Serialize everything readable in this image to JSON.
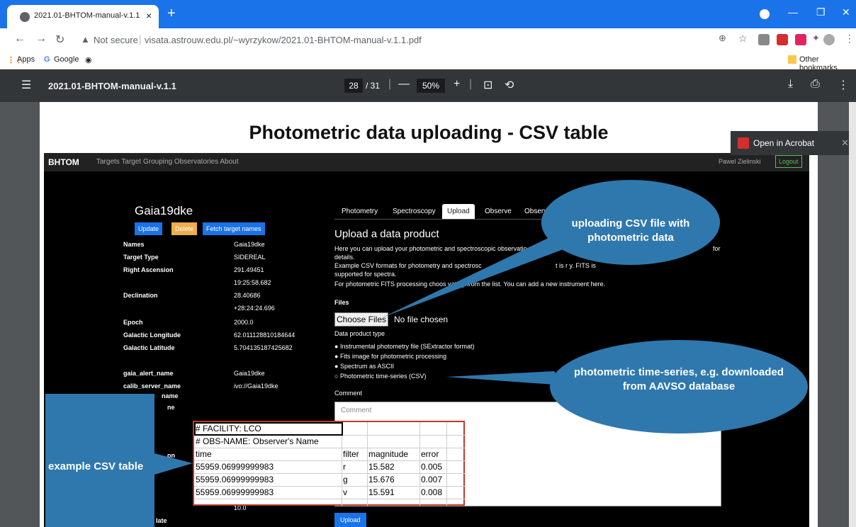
{
  "browser": {
    "tab_title": "2021.01-BHTOM-manual-v.1.1",
    "tab_close": "×",
    "new_tab": "+",
    "not_secure": "Not secure",
    "url": "visata.astrouw.edu.pl/~wyrzykow/2021.01-BHTOM-manual-v.1.1.pdf",
    "bookmarks": [
      "Apps",
      "Google"
    ],
    "other_bookmarks": "Other bookmarks"
  },
  "pdf_viewer": {
    "title": "2021.01-BHTOM-manual-v.1.1",
    "page_current": "28",
    "page_total": "/ 31",
    "zoom": "50%",
    "open_in_acrobat": "Open in Acrobat"
  },
  "slide": {
    "title": "Photometric data uploading - CSV table",
    "app": {
      "brand": "BHTOM",
      "nav_links": "Targets   Target Grouping   Observatories   About",
      "user": "Pawel Zielinski",
      "logout": "Logout",
      "target_name": "Gaia19dke",
      "buttons": [
        "Update",
        "Delete",
        "Fetch target names"
      ],
      "properties": [
        {
          "key": "Names",
          "value": "Gaia19dke"
        },
        {
          "key": "Target Type",
          "value": "SIDEREAL"
        },
        {
          "key": "Right Ascension",
          "value": "291.49451"
        },
        {
          "key": "",
          "value": "19:25:58.682"
        },
        {
          "key": "Declination",
          "value": "28.40686"
        },
        {
          "key": "",
          "value": "+28:24:24.696"
        },
        {
          "key": "Epoch",
          "value": "2000.0"
        },
        {
          "key": "Galactic Longitude",
          "value": "62.011128810184644"
        },
        {
          "key": "Galactic Latitude",
          "value": "5.704135187425682"
        },
        {
          "key": "gaia_alert_name",
          "value": "Gaia19dke"
        },
        {
          "key": "calib_server_name",
          "value": "ivo://Gaia19dke"
        },
        {
          "key": "name",
          "value": ""
        },
        {
          "key": "ne",
          "value": ""
        },
        {
          "key": "on",
          "value": ""
        },
        {
          "key": "",
          "value": "10.0"
        },
        {
          "key": "late",
          "value": ""
        }
      ],
      "tabs": [
        "Photometry",
        "Spectroscopy",
        "Upload",
        "Observe",
        "Observatio"
      ],
      "upload_title": "Upload a data product",
      "upload_text": [
        "Here you can upload your photometric and spectroscopic observatio",
        "details.",
        "Example CSV formats for photometry and spectrosc",
        "supported for spectra.",
        "For photometric FITS processing choos                    vatory from the list. You can add a new instrument here."
      ],
      "upload_text_right": [
        "for",
        "t is r                          y. FITS is"
      ],
      "files_label": "Files",
      "choose_files": "Choose Files",
      "no_file": "No file chosen",
      "data_product_type": "Data product type",
      "radio_options": [
        "Instrumental photometry file (SExtractor format)",
        "Fits image for photometric processing",
        "Spectrum as ASCII",
        "Photometric time-series (CSV)"
      ],
      "comment_label": "Comment",
      "comment_placeholder": "Comment",
      "upload_button": "Upload"
    },
    "csv_table": {
      "line1": "# FACILITY: LCO",
      "line2": "# OBS-NAME: Observer's Name",
      "headers": [
        "time",
        "filter",
        "magnitude",
        "error"
      ],
      "rows": [
        [
          "55959.06999999983",
          "r",
          "15.582",
          "0.005"
        ],
        [
          "55959.06999999983",
          "g",
          "15.676",
          "0.007"
        ],
        [
          "55959.06999999983",
          "v",
          "15.591",
          "0.008"
        ]
      ]
    },
    "callouts": {
      "upload_csv": "uploading CSV file with photometric data",
      "time_series": "photometric time-series, e.g. downloaded from AAVSO database",
      "example_csv": "example CSV table"
    }
  },
  "colors": {
    "chrome_blue": "#1a73e8",
    "callout_blue": "#2f78ad",
    "csv_border": "#c0392b",
    "pdf_toolbar": "#323639"
  }
}
